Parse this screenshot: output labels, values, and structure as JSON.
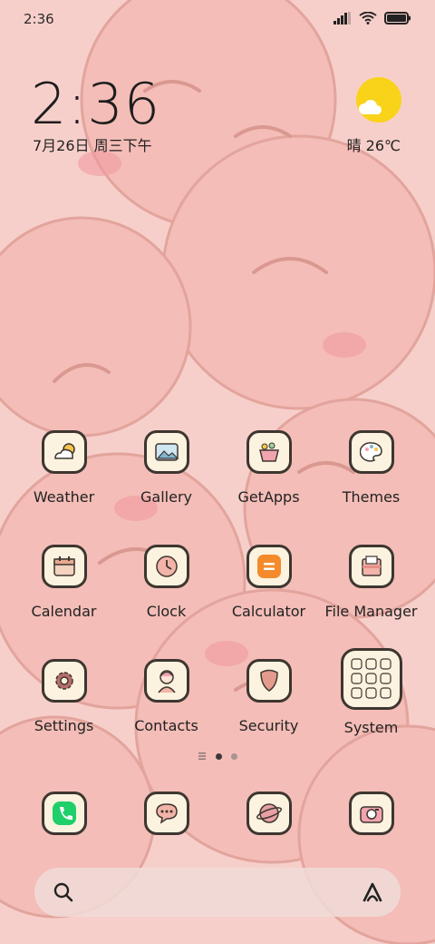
{
  "status": {
    "time": "2:36"
  },
  "lockclock": {
    "time": "2:36",
    "date": "7月26日 周三下午"
  },
  "weather": {
    "text": "晴 26℃"
  },
  "apps": [
    {
      "label": "Weather",
      "icon": "weather-icon"
    },
    {
      "label": "Gallery",
      "icon": "gallery-icon"
    },
    {
      "label": "GetApps",
      "icon": "getapps-icon"
    },
    {
      "label": "Themes",
      "icon": "themes-icon"
    },
    {
      "label": "Calendar",
      "icon": "calendar-icon"
    },
    {
      "label": "Clock",
      "icon": "clock-icon"
    },
    {
      "label": "Calculator",
      "icon": "calculator-icon"
    },
    {
      "label": "File Manager",
      "icon": "file-manager-icon"
    },
    {
      "label": "Settings",
      "icon": "settings-icon"
    },
    {
      "label": "Contacts",
      "icon": "contacts-icon"
    },
    {
      "label": "Security",
      "icon": "security-icon"
    },
    {
      "label": "System",
      "icon": "folder-icon"
    }
  ],
  "dock": [
    {
      "icon": "phone-icon"
    },
    {
      "icon": "messages-icon"
    },
    {
      "icon": "browser-icon"
    },
    {
      "icon": "camera-icon"
    }
  ],
  "colors": {
    "wallpaper_bg": "#f7cfca",
    "tile_bg": "#fbf3df",
    "tile_border": "#3e3630",
    "sun": "#f8d319",
    "calculator_accent": "#f58a2a",
    "phone_accent": "#1fcf6a"
  },
  "page_indicator": {
    "pages": 2,
    "current": 1
  }
}
